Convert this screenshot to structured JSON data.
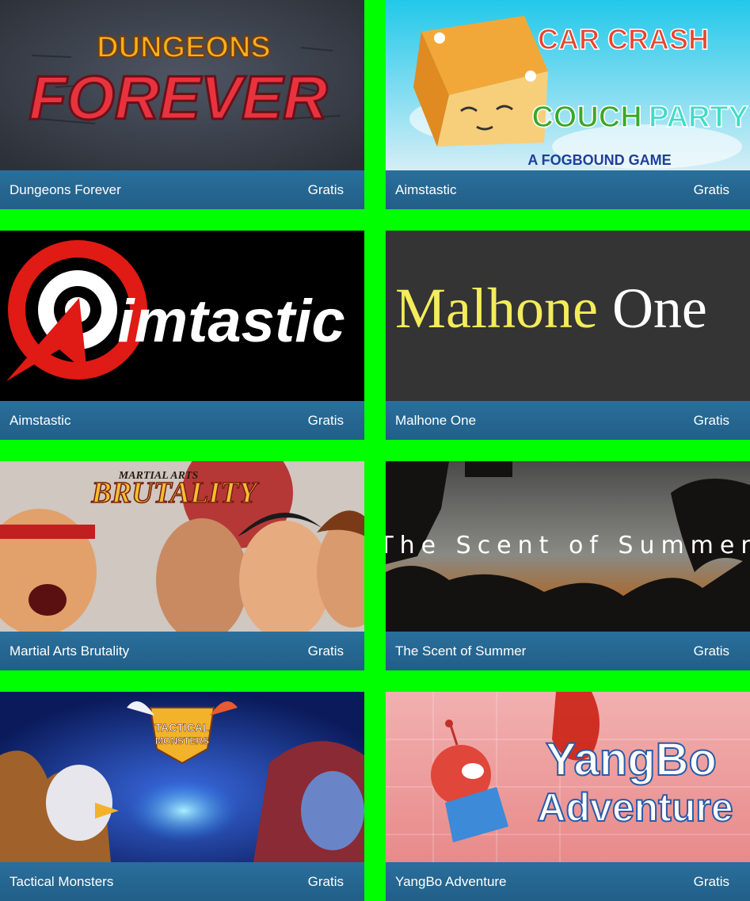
{
  "games": [
    {
      "name": "Dungeons Forever",
      "price": "Gratis",
      "art_top": "DUNGEONS",
      "art_bottom": "FOREVER"
    },
    {
      "name": "Aimstastic",
      "price": "Gratis",
      "art_line1": "CAR CRASH",
      "art_line2a": "COUCH",
      "art_line2b": "PARTY",
      "art_line3": "A FOGBOUND GAME"
    },
    {
      "name": "Aimstastic",
      "price": "Gratis",
      "art_text": "imtastic"
    },
    {
      "name": "Malhone One",
      "price": "Gratis",
      "art_a": "Malhone",
      "art_b": "One"
    },
    {
      "name": "Martial Arts Brutality",
      "price": "Gratis",
      "art_small": "MARTIAL ARTS",
      "art_big": "BRUTALITY"
    },
    {
      "name": "The Scent of Summer",
      "price": "Gratis",
      "art_text": "The Scent of Summer"
    },
    {
      "name": "Tactical Monsters",
      "price": "Gratis",
      "art_a": "TACTICAL",
      "art_b": "MONSTERS"
    },
    {
      "name": "YangBo Adventure",
      "price": "Gratis",
      "art_a": "YangBo",
      "art_b": "Adventure"
    }
  ]
}
